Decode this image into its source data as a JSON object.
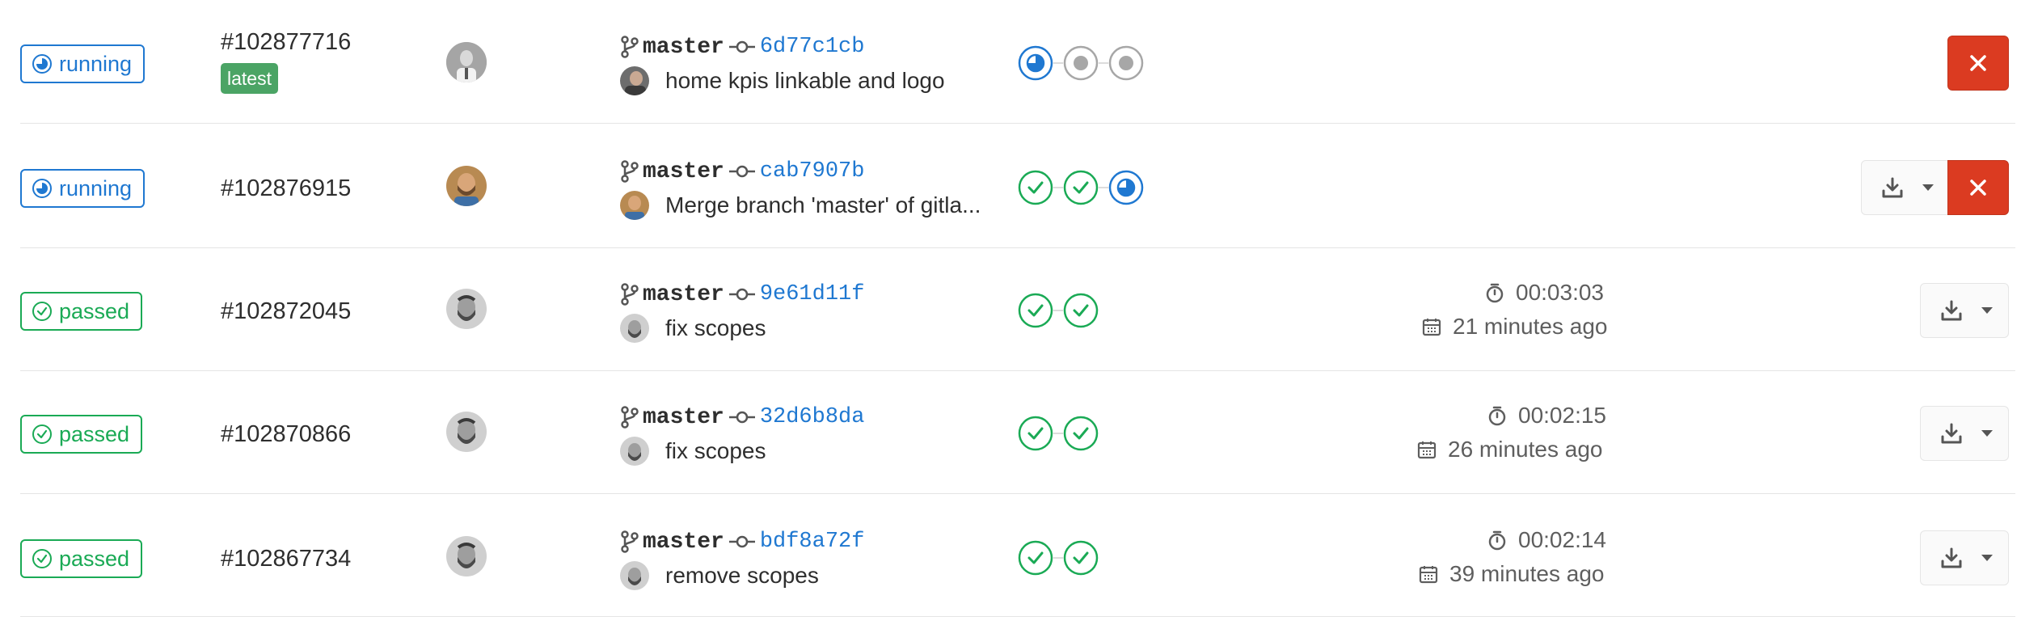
{
  "colors": {
    "running": "#1f78d1",
    "passed": "#1aaa55",
    "cancel": "#db3b21",
    "latest": "#4ba465",
    "border": "#e5e5e5"
  },
  "pipelines": [
    {
      "status": "running",
      "status_label": "running",
      "id": "#102877716",
      "badge": "latest",
      "branch": "master",
      "sha": "6d77c1cb",
      "message": "home kpis linkable and logo",
      "avatar": "man-in-suit",
      "stages": [
        "running",
        "created",
        "created"
      ],
      "duration": "",
      "finished": "",
      "actions": [
        "cancel"
      ]
    },
    {
      "status": "running",
      "status_label": "running",
      "id": "#102876915",
      "badge": "",
      "branch": "master",
      "sha": "cab7907b",
      "message": "Merge branch 'master' of gitla...",
      "avatar": "bearded-man-color",
      "stages": [
        "success",
        "success",
        "running"
      ],
      "duration": "",
      "finished": "",
      "actions": [
        "artifacts",
        "cancel"
      ]
    },
    {
      "status": "passed",
      "status_label": "passed",
      "id": "#102872045",
      "badge": "",
      "branch": "master",
      "sha": "9e61d11f",
      "message": "fix scopes",
      "avatar": "bearded-man-gray",
      "stages": [
        "success",
        "success"
      ],
      "duration": "00:03:03",
      "finished": "21 minutes ago",
      "actions": [
        "artifacts"
      ]
    },
    {
      "status": "passed",
      "status_label": "passed",
      "id": "#102870866",
      "badge": "",
      "branch": "master",
      "sha": "32d6b8da",
      "message": "fix scopes",
      "avatar": "bearded-man-gray",
      "stages": [
        "success",
        "success"
      ],
      "duration": "00:02:15",
      "finished": "26 minutes ago",
      "actions": [
        "artifacts"
      ]
    },
    {
      "status": "passed",
      "status_label": "passed",
      "id": "#102867734",
      "badge": "",
      "branch": "master",
      "sha": "bdf8a72f",
      "message": "remove scopes",
      "avatar": "bearded-man-gray",
      "stages": [
        "success",
        "success"
      ],
      "duration": "00:02:14",
      "finished": "39 minutes ago",
      "actions": [
        "artifacts"
      ]
    }
  ]
}
